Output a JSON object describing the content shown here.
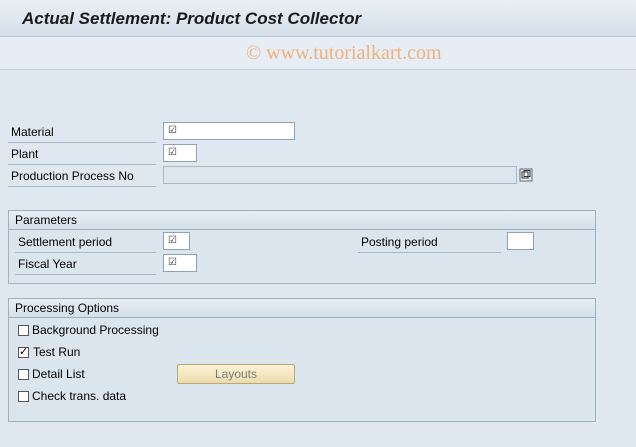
{
  "title": "Actual Settlement: Product Cost Collector",
  "watermark": "© www.tutorialkart.com",
  "fields": {
    "material_label": "Material",
    "plant_label": "Plant",
    "production_process_label": "Production Process No"
  },
  "parameters": {
    "heading": "Parameters",
    "settlement_period_label": "Settlement period",
    "fiscal_year_label": "Fiscal Year",
    "posting_period_label": "Posting period"
  },
  "processing": {
    "heading": "Processing Options",
    "background_processing_label": "Background Processing",
    "background_processing_checked": false,
    "test_run_label": "Test Run",
    "test_run_checked": true,
    "detail_list_label": "Detail List",
    "detail_list_checked": false,
    "check_trans_label": "Check trans. data",
    "check_trans_checked": false,
    "layouts_button": "Layouts"
  },
  "icons": {
    "required": "required-checkmark-icon",
    "possible_entries": "possible-entries-icon"
  }
}
